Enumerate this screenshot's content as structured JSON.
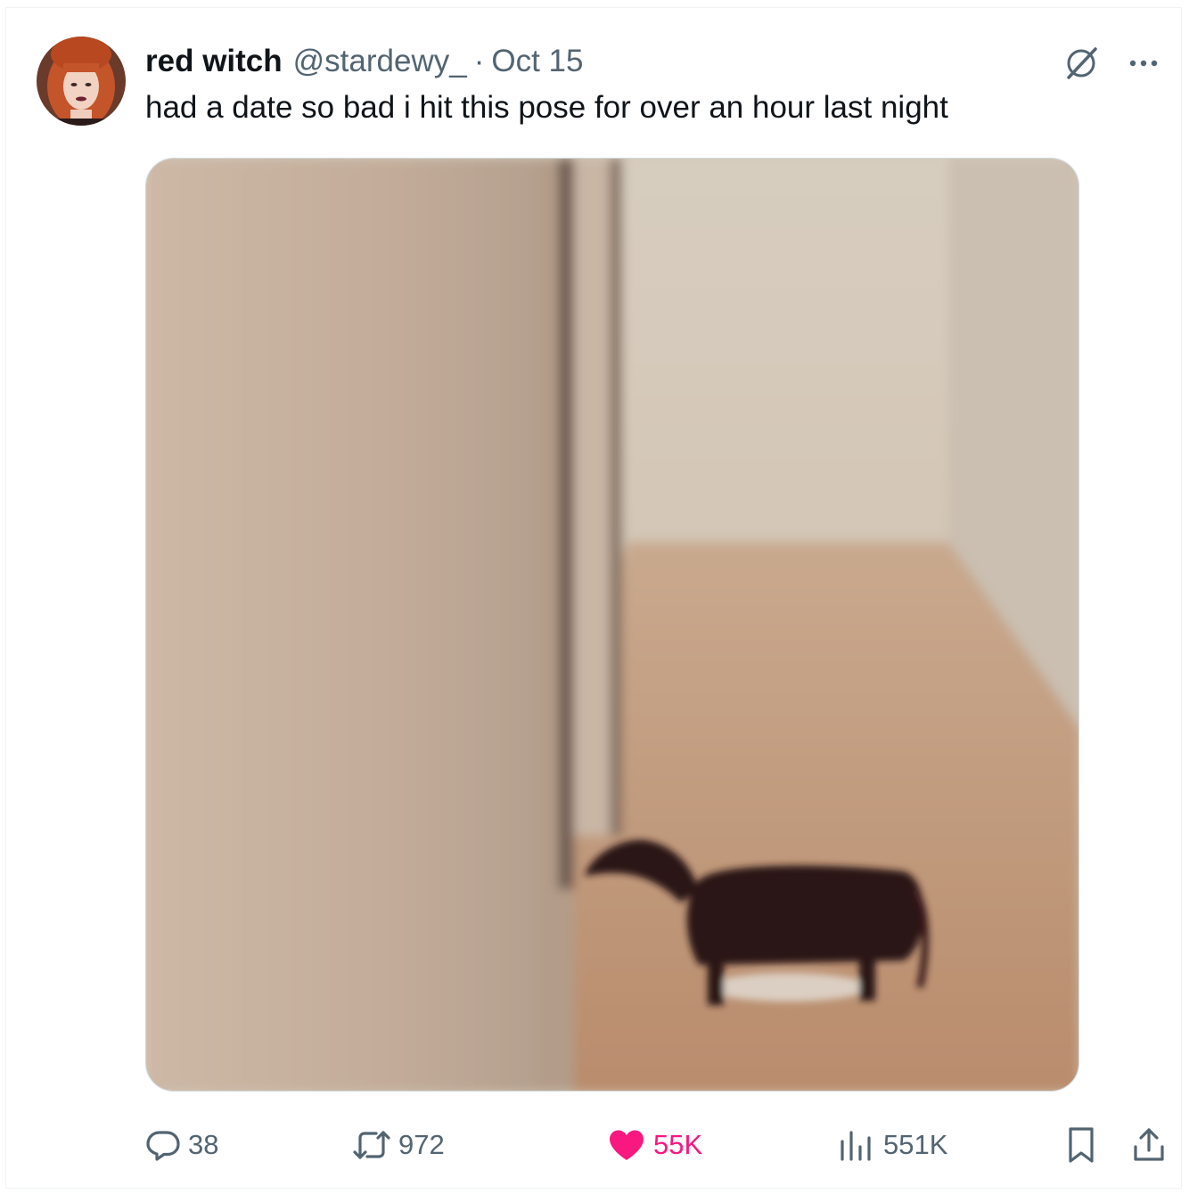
{
  "tweet": {
    "author_name": "red witch",
    "author_handle": "@stardewy_",
    "separator": "·",
    "date": "Oct 15",
    "text": "had a date so bad i hit this pose for over an hour last night"
  },
  "icons": {
    "avatar": "avatar",
    "grok": "grok-icon",
    "more": "more-icon",
    "reply": "reply-icon",
    "retweet": "retweet-icon",
    "like": "heart-icon",
    "views": "views-icon",
    "bookmark": "bookmark-icon",
    "share": "share-icon"
  },
  "metrics": {
    "replies": "38",
    "retweets": "972",
    "likes": "55K",
    "views": "551K"
  },
  "colors": {
    "text_primary": "#0f1419",
    "text_secondary": "#536471",
    "like_active": "#f91880",
    "border": "#cfd9de"
  }
}
